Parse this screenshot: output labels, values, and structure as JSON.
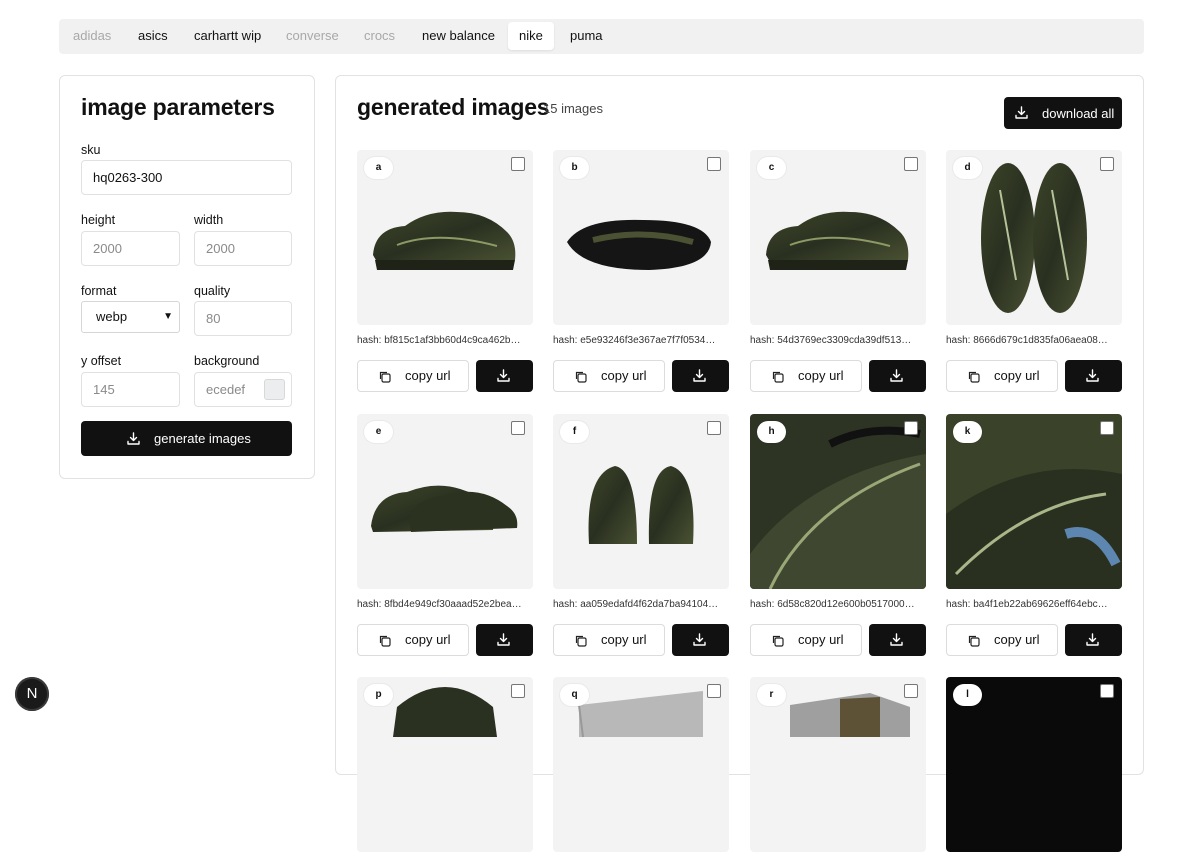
{
  "brands": [
    {
      "label": "adidas",
      "state": "disabled"
    },
    {
      "label": "asics",
      "state": "normal"
    },
    {
      "label": "carhartt wip",
      "state": "normal"
    },
    {
      "label": "converse",
      "state": "disabled"
    },
    {
      "label": "crocs",
      "state": "disabled"
    },
    {
      "label": "new balance",
      "state": "normal"
    },
    {
      "label": "nike",
      "state": "active"
    },
    {
      "label": "puma",
      "state": "normal"
    }
  ],
  "params": {
    "title": "image parameters",
    "sku_label": "sku",
    "sku_value": "hq0263-300",
    "height_label": "height",
    "height_placeholder": "2000",
    "width_label": "width",
    "width_placeholder": "2000",
    "format_label": "format",
    "format_value": "webp",
    "quality_label": "quality",
    "quality_placeholder": "80",
    "yoffset_label": "y offset",
    "yoffset_placeholder": "145",
    "background_label": "background",
    "background_placeholder": "ecedef",
    "background_color": "#ecedef",
    "generate_label": "generate images"
  },
  "gallery": {
    "title": "generated images",
    "count": "15 images",
    "download_all_label": "download all",
    "copy_label": "copy url",
    "cards": [
      {
        "letter": "a",
        "hash": "hash: bf815c1af3bb60d4c9ca462b…",
        "view": "side"
      },
      {
        "letter": "b",
        "hash": "hash: e5e93246f3e367ae7f7f0534…",
        "view": "sole"
      },
      {
        "letter": "c",
        "hash": "hash: 54d3769ec3309cda39df513…",
        "view": "side"
      },
      {
        "letter": "d",
        "hash": "hash: 8666d679c1d835fa06aea08…",
        "view": "top"
      },
      {
        "letter": "e",
        "hash": "hash: 8fbd4e949cf30aaad52e2bea…",
        "view": "pair"
      },
      {
        "letter": "f",
        "hash": "hash: aa059edafd4f62da7ba94104…",
        "view": "back"
      },
      {
        "letter": "h",
        "hash": "hash: 6d58c820d12e600b0517000…",
        "view": "detail"
      },
      {
        "letter": "k",
        "hash": "hash: ba4f1eb22ab69626eff64ebc…",
        "view": "detail2"
      },
      {
        "letter": "p",
        "hash": "",
        "view": "partial"
      },
      {
        "letter": "q",
        "hash": "",
        "view": "box"
      },
      {
        "letter": "r",
        "hash": "",
        "view": "box2"
      },
      {
        "letter": "l",
        "hash": "",
        "view": "dark"
      }
    ]
  },
  "fab_label": "N"
}
